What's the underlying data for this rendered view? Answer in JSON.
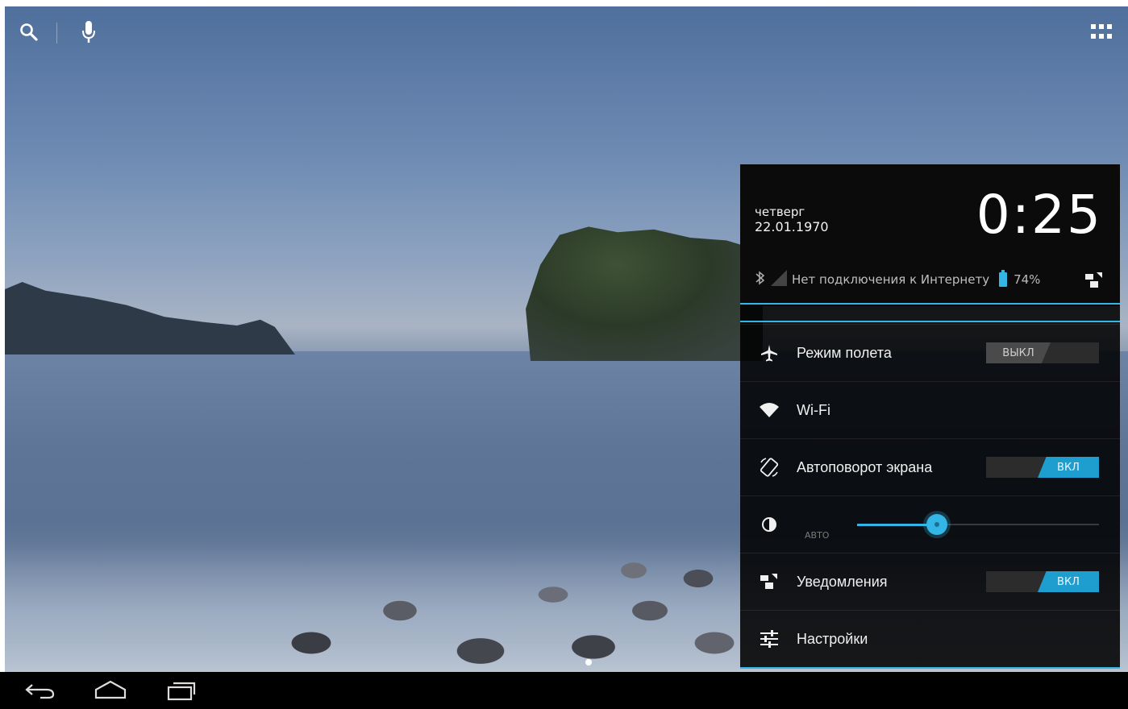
{
  "panel": {
    "day": "четверг",
    "date": "22.01.1970",
    "time": "0:25",
    "network_status": "Нет подключения к Интернету",
    "battery": "74%",
    "accent": "#33b5e5"
  },
  "settings": {
    "airplane": {
      "label": "Режим полета",
      "state": "ВЫКЛ"
    },
    "wifi": {
      "label": "Wi-Fi"
    },
    "rotation": {
      "label": "Автоповорот экрана",
      "state": "ВКЛ"
    },
    "brightness": {
      "auto_label": "АВТО",
      "level": 0.33
    },
    "notifications": {
      "label": "Уведомления",
      "state": "ВКЛ"
    },
    "settings_item": {
      "label": "Настройки"
    }
  },
  "icons": {
    "top_left": [
      "search-icon",
      "mic-icon"
    ],
    "top_right": "apps-grid-icon",
    "nav": [
      "back-icon",
      "home-icon",
      "recent-apps-icon"
    ]
  }
}
